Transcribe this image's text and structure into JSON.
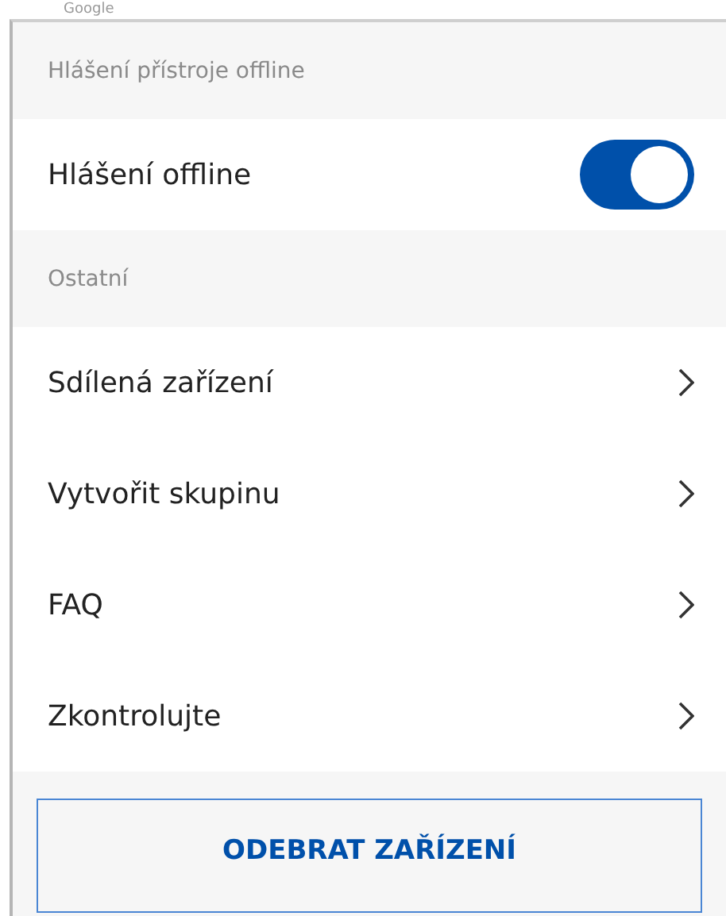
{
  "top_cut_text": "Google",
  "sections": [
    {
      "header": "Hlášení přístroje offline",
      "rows": [
        {
          "kind": "toggle",
          "label": "Hlášení offline",
          "on": true
        }
      ]
    },
    {
      "header": "Ostatní",
      "rows": [
        {
          "kind": "link",
          "label": "Sdílená zařízení"
        },
        {
          "kind": "link",
          "label": "Vytvořit skupinu"
        },
        {
          "kind": "link",
          "label": "FAQ"
        },
        {
          "kind": "link",
          "label": "Zkontrolujte"
        }
      ]
    }
  ],
  "remove_button": "ODEBRAT ZAŘÍZENÍ"
}
